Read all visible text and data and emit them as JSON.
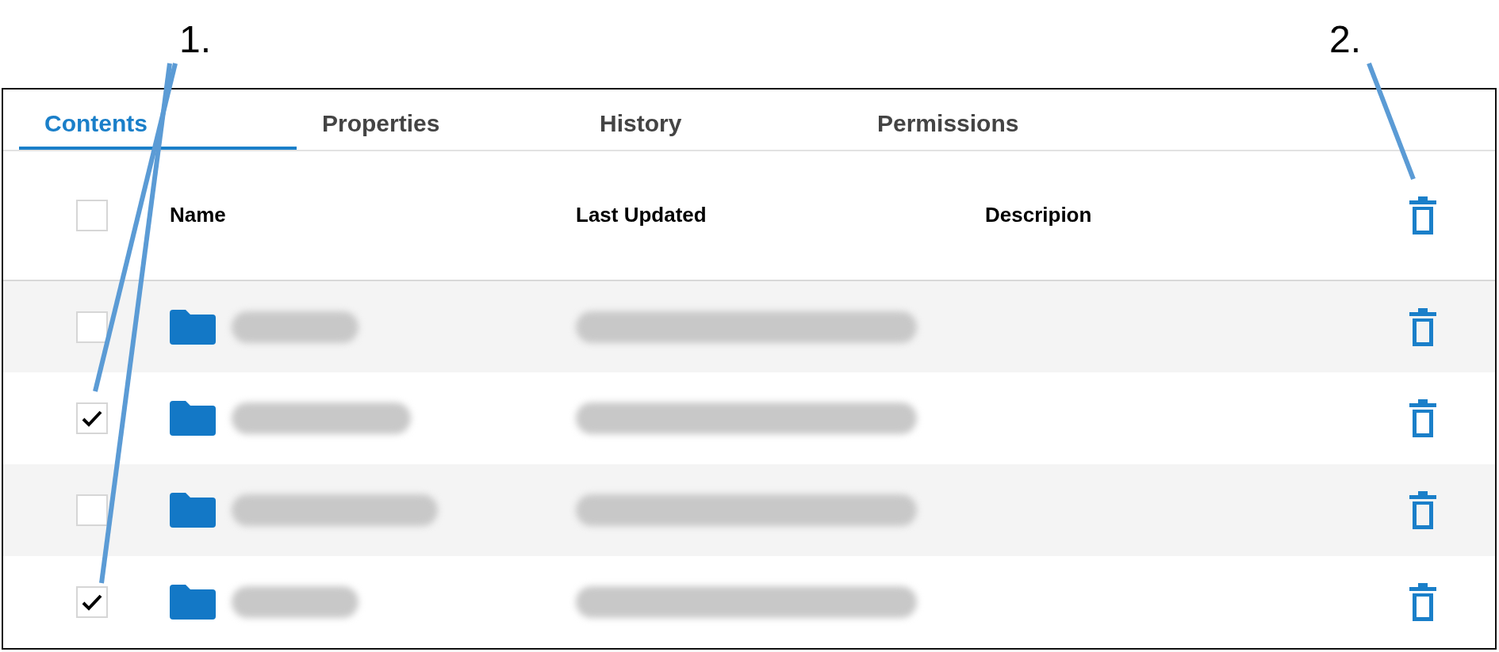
{
  "annotations": [
    {
      "label": "1."
    },
    {
      "label": "2."
    }
  ],
  "tabs": [
    {
      "label": "Contents",
      "selected": true
    },
    {
      "label": "Properties",
      "selected": false
    },
    {
      "label": "History",
      "selected": false
    },
    {
      "label": "Permissions",
      "selected": false
    }
  ],
  "table": {
    "select_all": {
      "checked": false
    },
    "columns": [
      "Name",
      "Last Updated",
      "Descripion"
    ],
    "rows": [
      {
        "checked": false
      },
      {
        "checked": true
      },
      {
        "checked": false
      },
      {
        "checked": true
      }
    ]
  }
}
